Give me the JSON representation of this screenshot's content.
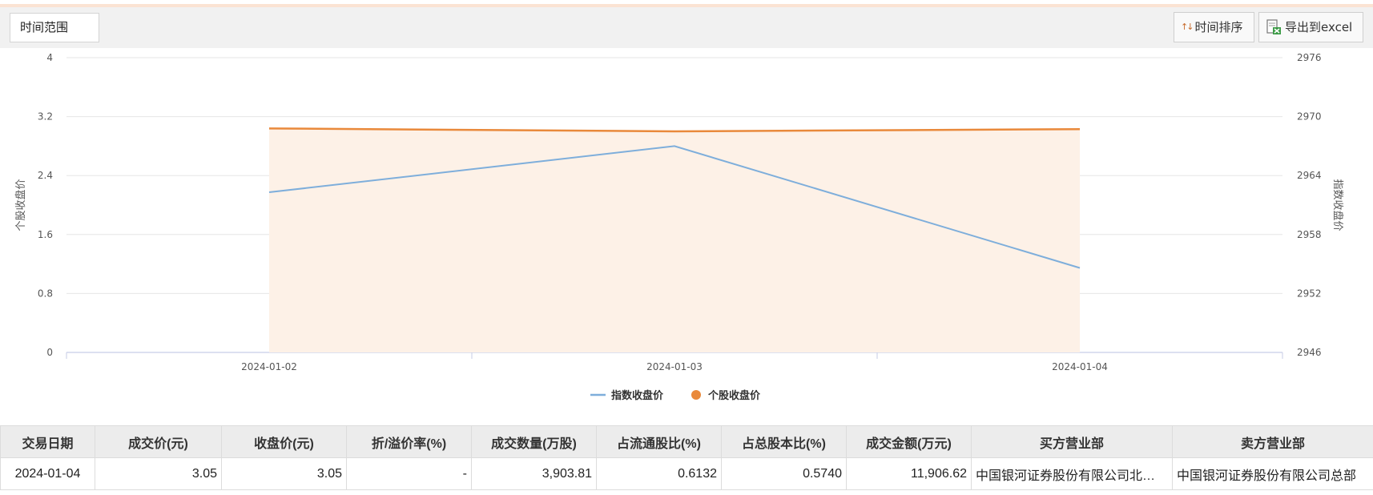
{
  "toolbar": {
    "range_label": "时间范围",
    "sort_label": "时间排序",
    "export_label": "导出到excel"
  },
  "colors": {
    "index_line": "#7eaedb",
    "stock_line": "#e9893b",
    "stock_area": "#fdf1e7",
    "grid": "#e6e6e6",
    "axis_text": "#555555"
  },
  "chart_data": {
    "type": "line",
    "categories": [
      "2024-01-02",
      "2024-01-03",
      "2024-01-04"
    ],
    "series": [
      {
        "name": "指数收盘价",
        "axis": "right",
        "style": "line",
        "values": [
          2962.3,
          2967.0,
          2954.6
        ]
      },
      {
        "name": "个股收盘价",
        "axis": "left",
        "style": "area",
        "values": [
          3.04,
          3.0,
          3.03
        ]
      }
    ],
    "left_axis": {
      "label": "个股收盘价",
      "ticks": [
        "4",
        "3.2",
        "2.4",
        "1.6",
        "0.8",
        "0"
      ],
      "ylim": [
        0,
        4
      ]
    },
    "right_axis": {
      "label": "指数收盘价",
      "ticks": [
        "2976",
        "2970",
        "2964",
        "2958",
        "2952",
        "2946"
      ],
      "ylim": [
        2946,
        2976
      ]
    },
    "legend": "bottom-center",
    "grid": true
  },
  "table": {
    "headers": [
      "交易日期",
      "成交价(元)",
      "收盘价(元)",
      "折/溢价率(%)",
      "成交数量(万股)",
      "占流通股比(%)",
      "占总股本比(%)",
      "成交金额(万元)",
      "买方营业部",
      "卖方营业部"
    ],
    "rows": [
      [
        "2024-01-04",
        "3.05",
        "3.05",
        "-",
        "3,903.81",
        "0.6132",
        "0.5740",
        "11,906.62",
        "中国银河证券股份有限公司北…",
        "中国银河证券股份有限公司总部"
      ]
    ]
  }
}
